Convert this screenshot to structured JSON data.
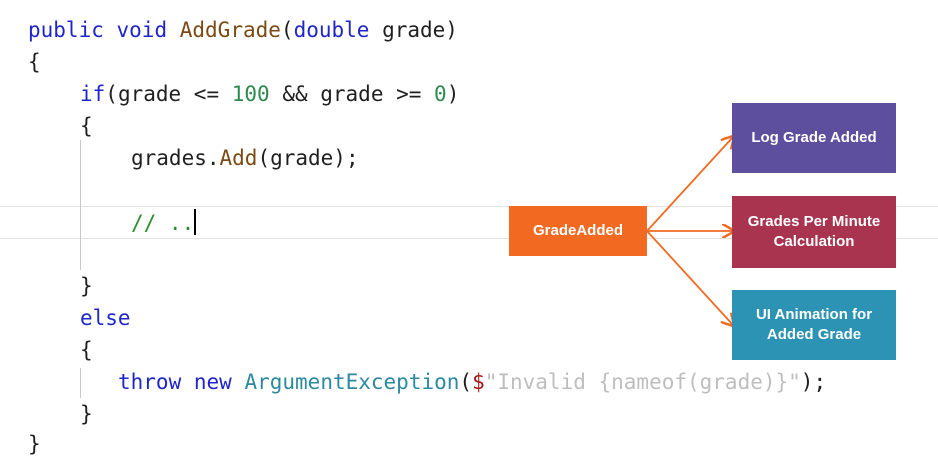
{
  "code": {
    "line1": {
      "kw_public": "public",
      "kw_void": "void",
      "method": "AddGrade",
      "paren_open": "(",
      "type_double": "double",
      "param": "grade",
      "paren_close": ")"
    },
    "line2": "{",
    "line3": {
      "kw_if": "if",
      "cond_a": "(grade <= ",
      "num_a": "100",
      "cond_b": " && grade >= ",
      "num_b": "0",
      "cond_c": ")"
    },
    "line4": "{",
    "line5": {
      "obj": "grades.",
      "method": "Add",
      "args": "(grade);"
    },
    "line7": {
      "comment": "// .."
    },
    "line9": "}",
    "line10": "else",
    "line11": "{",
    "line12": {
      "kw_throw": "throw",
      "kw_new": "new",
      "cls": "ArgumentException",
      "open": "(",
      "str_start": "$",
      "ghost": "\"Invalid {nameof(grade)}\"",
      "end": ");"
    },
    "line13": "}",
    "line14": "}"
  },
  "diagram": {
    "source": "GradeAdded",
    "targets": [
      "Log Grade Added",
      "Grades Per Minute Calculation",
      "UI Animation for Added Grade"
    ],
    "colors": {
      "source": "#f26a22",
      "target1": "#5d4f9e",
      "target2": "#a8344f",
      "target3": "#2c93b5",
      "arrow": "#f26a22"
    }
  }
}
